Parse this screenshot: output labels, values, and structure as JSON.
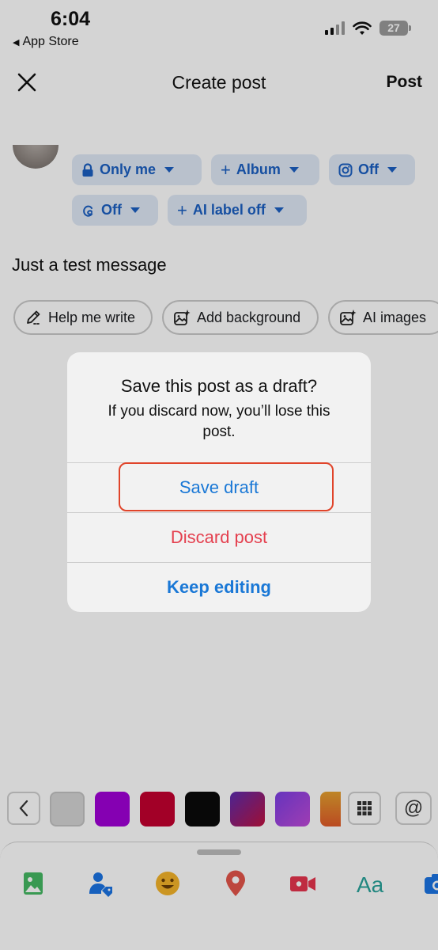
{
  "status_bar": {
    "time": "6:04",
    "back_label": "App Store",
    "battery": "27"
  },
  "header": {
    "title": "Create post",
    "post_label": "Post"
  },
  "audience_chips": [
    {
      "label": "Only me",
      "icon": "lock-icon"
    },
    {
      "label": "Album",
      "icon": "plus-icon"
    },
    {
      "label": "Off",
      "icon": "instagram-icon"
    },
    {
      "label": "Off",
      "icon": "threads-icon"
    },
    {
      "label": "AI label off",
      "icon": "plus-icon"
    }
  ],
  "message": "Just a test message",
  "suggestions": [
    {
      "label": "Help me write",
      "icon": "pencil-icon"
    },
    {
      "label": "Add background",
      "icon": "image-sparkle-icon"
    },
    {
      "label": "AI images",
      "icon": "image-sparkle-icon"
    }
  ],
  "dialog": {
    "title": "Save this post as a draft?",
    "message": "If you discard now, you’ll lose this post.",
    "save_label": "Save draft",
    "discard_label": "Discard post",
    "keep_label": "Keep editing"
  },
  "colors": {
    "chip_text": "#1b5fc2",
    "dialog_action": "#1a78d6",
    "destructive": "#e4404f",
    "highlight": "#e0442a",
    "swatches": [
      "#d4d4d4",
      "#a100d6",
      "#c3002f",
      "#0a0a0a",
      "gradient-purple-red",
      "gradient-violet",
      "gradient-orange"
    ]
  },
  "tools": [
    "photo-icon",
    "tag-people-icon",
    "feeling-icon",
    "location-icon",
    "live-video-icon",
    "text-style-icon",
    "camera-icon"
  ]
}
